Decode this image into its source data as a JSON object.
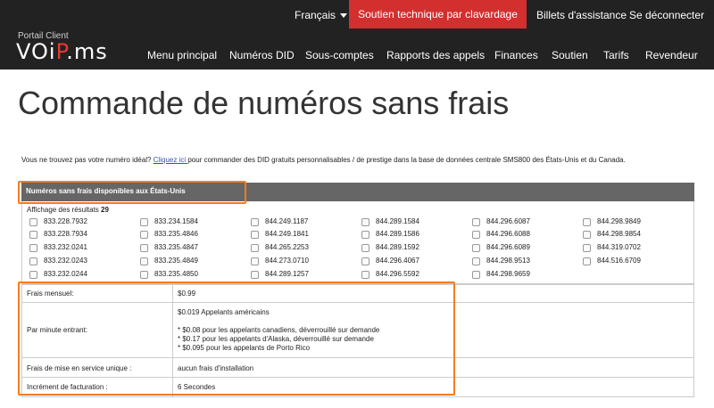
{
  "topbar": {
    "language": "Français",
    "chat_support": "Soutien technique par clavardage",
    "tickets": "Billets d'assistance",
    "logout": "Se déconnecter"
  },
  "logo": {
    "subtitle": "Portail Client",
    "name_part1": "VOi",
    "name_accent": "P",
    "name_part2": ".ms"
  },
  "nav": [
    "Menu principal",
    "Numéros DID",
    "Sous-comptes",
    "Rapports des appels",
    "Finances",
    "Soutien",
    "Tarifs",
    "Revendeur"
  ],
  "page_title": "Commande de numéros sans frais",
  "intro": {
    "before_link": "Vous ne trouvez pas votre numéro idéal? ",
    "link": "Cliquez ici ",
    "after_link": "pour commander des DID gratuits personnalisables / de prestige dans la base de données centrale SMS800 des États-Unis et du Canada."
  },
  "table": {
    "header": "Numéros sans frais disponibles aux États-Unis",
    "results_label": "Affichage des résultats",
    "results_count": "29",
    "numbers": [
      [
        "833.228.7932",
        "833.228.7934",
        "833.232.0241",
        "833.232.0243",
        "833.232.0244"
      ],
      [
        "833.234.1584",
        "833.235.4846",
        "833.235.4847",
        "833.235.4849",
        "833.235.4850"
      ],
      [
        "844.249.1187",
        "844.249.1841",
        "844.265.2253",
        "844.273.0710",
        "844.289.1257"
      ],
      [
        "844.289.1584",
        "844.289.1586",
        "844.289.1592",
        "844.296.4067",
        "844.296.5592"
      ],
      [
        "844.296.6087",
        "844.296.6088",
        "844.296.6089",
        "844.298.9513",
        "844.298.9659"
      ],
      [
        "844.298.9849",
        "844.298.9854",
        "844.319.0702",
        "844.516.6709"
      ]
    ]
  },
  "details": {
    "monthly_label": "Frais mensuel:",
    "monthly_value": "$0.99",
    "per_minute_label": "Par minute entrant:",
    "per_minute_lines": [
      "$0.019 Appelants américains",
      "",
      "* $0.08 pour les appelants canadiens, déverrouillé sur demande",
      "* $0.17 pour les appelants d'Alaska, déverrouillé sur demande",
      "* $0.095 pour les appelants de Porto Rico"
    ],
    "setup_label": "Frais de mise en service unique :",
    "setup_value": "aucun frais d'installation",
    "increment_label": "Incrément de facturation :",
    "increment_value": "6 Secondes"
  },
  "colors": {
    "header_bg": "#222222",
    "chat_button": "#d32f2f",
    "table_header_bg": "#666666",
    "highlight": "#f57c1f"
  }
}
